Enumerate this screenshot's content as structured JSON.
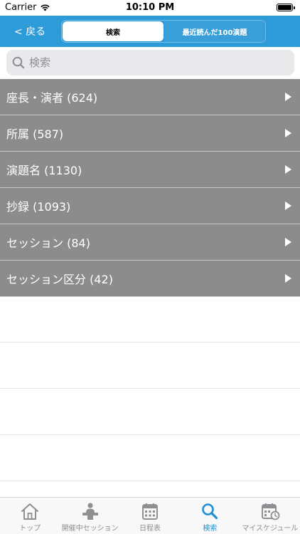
{
  "status_bar": {
    "carrier": "Carrier",
    "time": "10:10 PM",
    "battery_level": 1.0
  },
  "nav": {
    "back_label": "< 戻る",
    "segments": [
      {
        "label": "検索",
        "active": true
      },
      {
        "label": "最近読んだ100演題",
        "active": false
      }
    ],
    "accent_color": "#2d9bd8"
  },
  "search": {
    "placeholder": "検索"
  },
  "categories": [
    {
      "label": "座長・演者 (624)"
    },
    {
      "label": "所属 (587)"
    },
    {
      "label": "演題名 (1130)"
    },
    {
      "label": "抄録 (1093)"
    },
    {
      "label": "セッション (84)"
    },
    {
      "label": "セッション区分 (42)"
    }
  ],
  "tab_bar": {
    "items": [
      {
        "label": "トップ",
        "icon": "home-icon"
      },
      {
        "label": "開催中セッション",
        "icon": "presenter-icon"
      },
      {
        "label": "日程表",
        "icon": "calendar-icon"
      },
      {
        "label": "検索",
        "icon": "search-icon",
        "active": true
      },
      {
        "label": "マイスケジュール",
        "icon": "calendar-clock-icon"
      }
    ],
    "active_color": "#1e90d8",
    "inactive_color": "#8e8e93"
  }
}
